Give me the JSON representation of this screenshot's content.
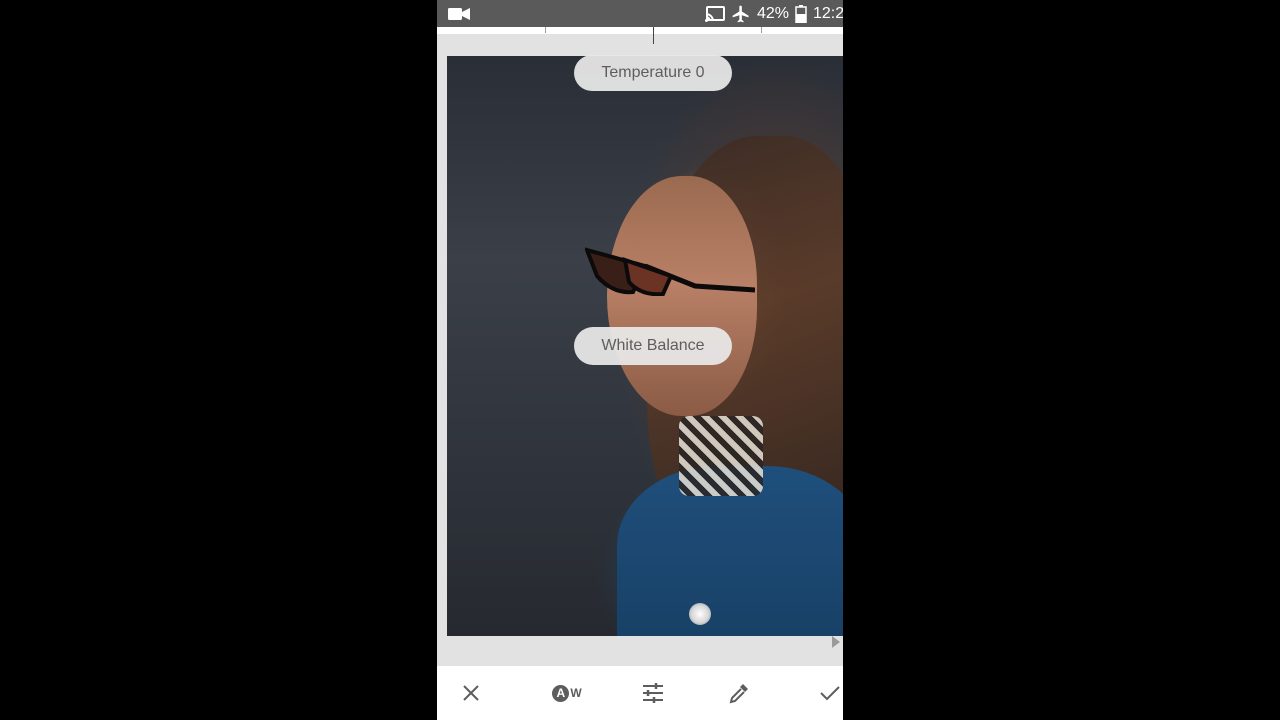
{
  "status_bar": {
    "battery_percent": "42%",
    "time": "12:2",
    "icons": [
      "video-camera-icon",
      "cast-icon",
      "airplane-mode-icon",
      "battery-icon"
    ]
  },
  "editor": {
    "adjustment_label": "Temperature 0",
    "tool_label": "White Balance"
  },
  "bottom_bar": {
    "buttons": [
      "close-icon",
      "auto-white-balance-icon",
      "tune-sliders-icon",
      "eyedropper-icon",
      "checkmark-icon"
    ],
    "auto_letter": "A",
    "auto_suffix": "W"
  },
  "colors": {
    "status_bar_bg": "#5a5a5a",
    "pill_bg": "#e8e8e8",
    "icon_color": "#5d5d5d"
  }
}
